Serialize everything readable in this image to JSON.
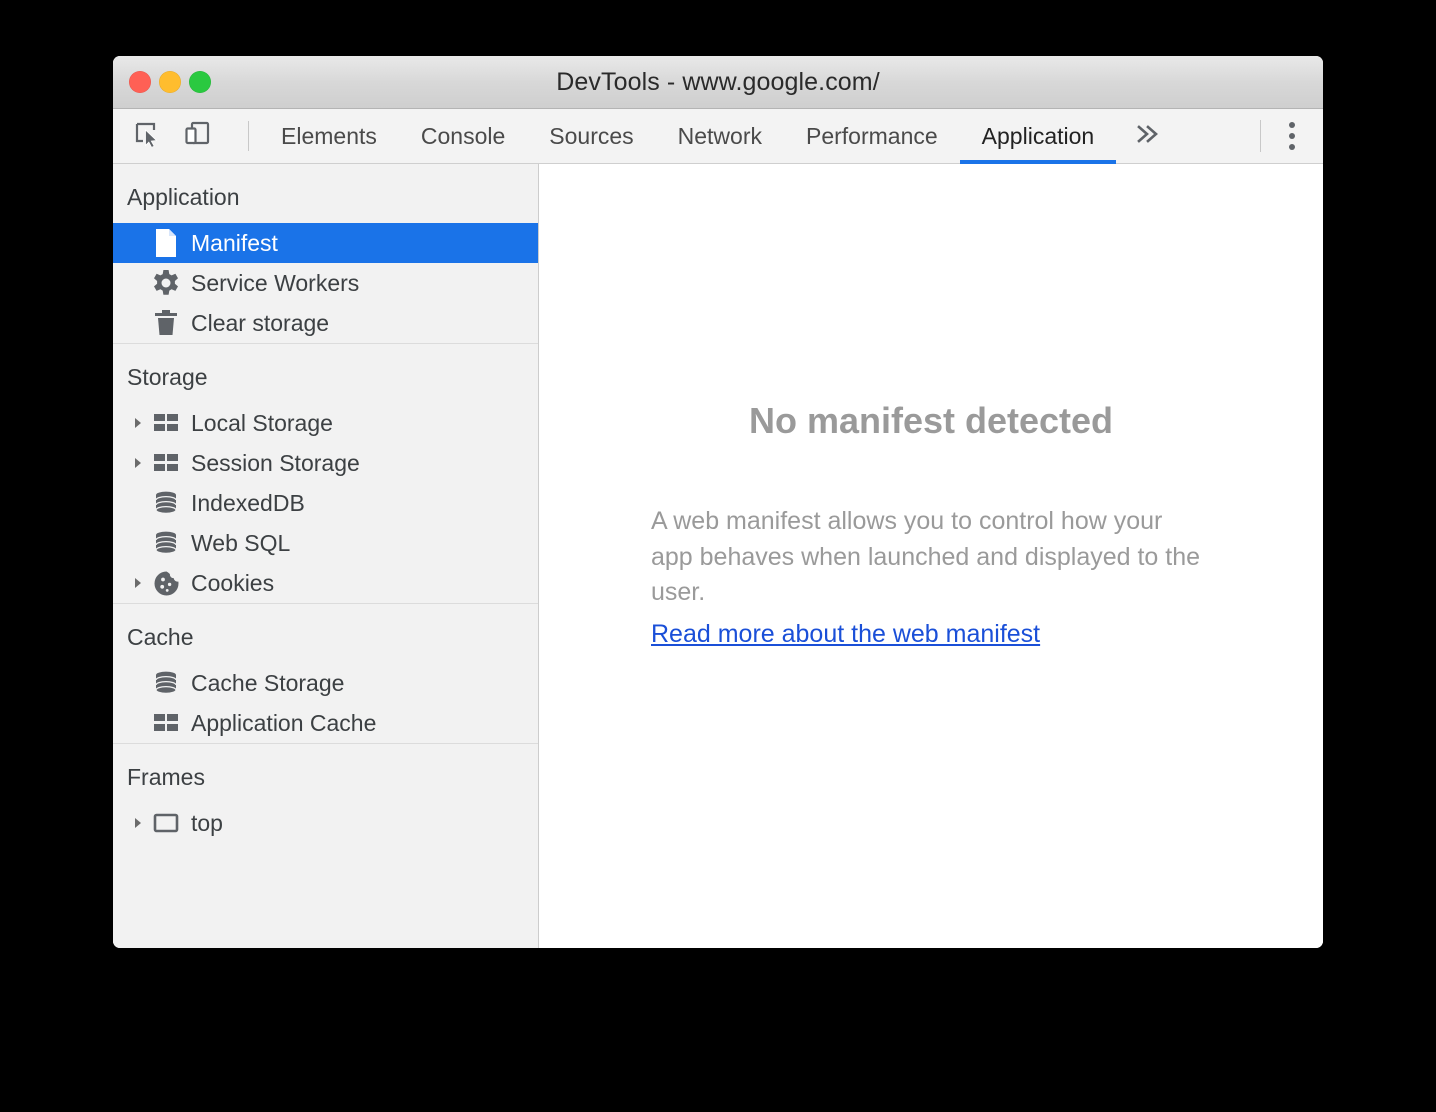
{
  "window": {
    "title": "DevTools - www.google.com/",
    "traffic_lights": [
      {
        "name": "close",
        "color": "#ff6055"
      },
      {
        "name": "minimize",
        "color": "#ffbd2e"
      },
      {
        "name": "maximize",
        "color": "#2ac940"
      }
    ]
  },
  "toolbar": {
    "tools": [
      {
        "name": "inspect-element-icon",
        "label": "Inspect element"
      },
      {
        "name": "device-toolbar-icon",
        "label": "Toggle device toolbar"
      }
    ],
    "tabs": [
      {
        "label": "Elements",
        "active": false
      },
      {
        "label": "Console",
        "active": false
      },
      {
        "label": "Sources",
        "active": false
      },
      {
        "label": "Network",
        "active": false
      },
      {
        "label": "Performance",
        "active": false
      },
      {
        "label": "Application",
        "active": true
      }
    ],
    "more_tabs_label": "»",
    "menu_label": "Customize and control DevTools",
    "active_tab_accent": "#1a73e8"
  },
  "sidebar": {
    "sections": [
      {
        "title": "Application",
        "items": [
          {
            "label": "Manifest",
            "icon": "document-icon",
            "selected": true,
            "expandable": false
          },
          {
            "label": "Service Workers",
            "icon": "gear-icon",
            "selected": false,
            "expandable": false
          },
          {
            "label": "Clear storage",
            "icon": "trash-icon",
            "selected": false,
            "expandable": false
          }
        ]
      },
      {
        "title": "Storage",
        "items": [
          {
            "label": "Local Storage",
            "icon": "table-icon",
            "selected": false,
            "expandable": true
          },
          {
            "label": "Session Storage",
            "icon": "table-icon",
            "selected": false,
            "expandable": true
          },
          {
            "label": "IndexedDB",
            "icon": "database-icon",
            "selected": false,
            "expandable": false
          },
          {
            "label": "Web SQL",
            "icon": "database-icon",
            "selected": false,
            "expandable": false
          },
          {
            "label": "Cookies",
            "icon": "cookie-icon",
            "selected": false,
            "expandable": true
          }
        ]
      },
      {
        "title": "Cache",
        "items": [
          {
            "label": "Cache Storage",
            "icon": "database-icon",
            "selected": false,
            "expandable": false
          },
          {
            "label": "Application Cache",
            "icon": "table-icon",
            "selected": false,
            "expandable": false
          }
        ]
      },
      {
        "title": "Frames",
        "items": [
          {
            "label": "top",
            "icon": "frame-icon",
            "selected": false,
            "expandable": true
          }
        ]
      }
    ],
    "selected_bg": "#1a73e8"
  },
  "main": {
    "empty_state": {
      "title": "No manifest detected",
      "description": "A web manifest allows you to control how your app behaves when launched and displayed to the user.",
      "link_text": "Read more about the web manifest",
      "link_color": "#1a4fd8"
    }
  }
}
